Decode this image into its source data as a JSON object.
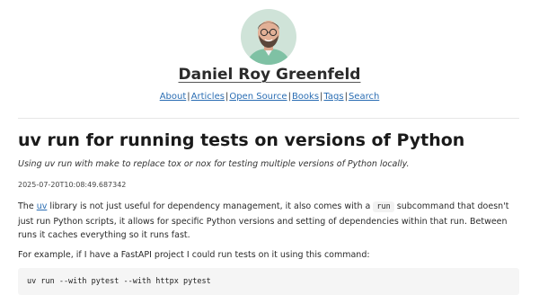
{
  "site": {
    "title": "Daniel Roy Greenfeld"
  },
  "nav": {
    "items": [
      {
        "label": "About"
      },
      {
        "label": "Articles"
      },
      {
        "label": "Open Source"
      },
      {
        "label": "Books"
      },
      {
        "label": "Tags"
      },
      {
        "label": "Search"
      }
    ],
    "separator": "|"
  },
  "post": {
    "title": "uv run for running tests on versions of Python",
    "subtitle": "Using uv run with make to replace tox or nox for testing multiple versions of Python locally.",
    "timestamp": "2025-07-20T10:08:49.687342",
    "p1": {
      "before": "The ",
      "link": "uv",
      "middle": " library is not just useful for dependency management, it also comes with a ",
      "code": "run",
      "after": " subcommand that doesn't just run Python scripts, it allows for specific Python versions and setting of dependencies within that run. Between runs it caches everything so it runs fast."
    },
    "p2": "For example, if I have a FastAPI project I could run tests on it using this command:",
    "code_block": "uv run --with pytest --with httpx pytest"
  },
  "colors": {
    "link": "#2a6db3",
    "code_bg": "#f5f5f5",
    "avatar_bg": "#8fbfa8"
  }
}
